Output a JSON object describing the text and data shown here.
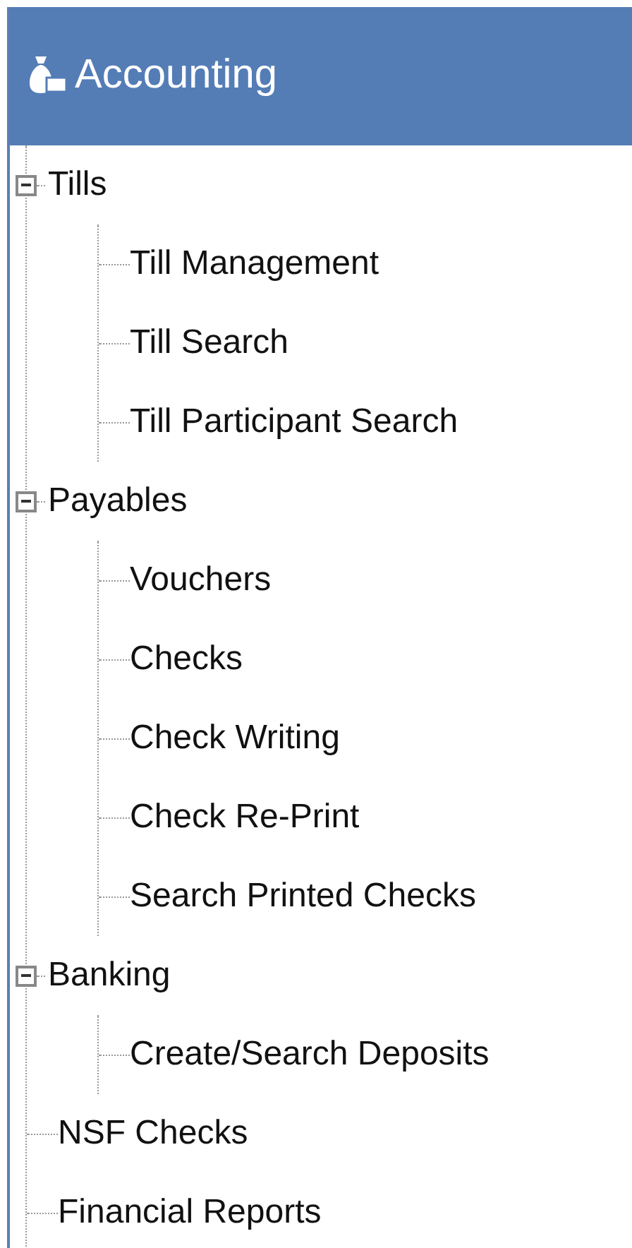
{
  "header": {
    "title": "Accounting"
  },
  "tree": [
    {
      "label": "Tills",
      "expanded": true,
      "children": [
        {
          "label": "Till Management"
        },
        {
          "label": "Till Search"
        },
        {
          "label": "Till Participant Search"
        }
      ]
    },
    {
      "label": "Payables",
      "expanded": true,
      "children": [
        {
          "label": "Vouchers"
        },
        {
          "label": "Checks"
        },
        {
          "label": "Check Writing"
        },
        {
          "label": "Check Re-Print"
        },
        {
          "label": "Search Printed Checks"
        }
      ]
    },
    {
      "label": "Banking",
      "expanded": true,
      "children": [
        {
          "label": "Create/Search Deposits"
        }
      ]
    },
    {
      "label": "NSF Checks"
    },
    {
      "label": "Financial Reports"
    }
  ]
}
